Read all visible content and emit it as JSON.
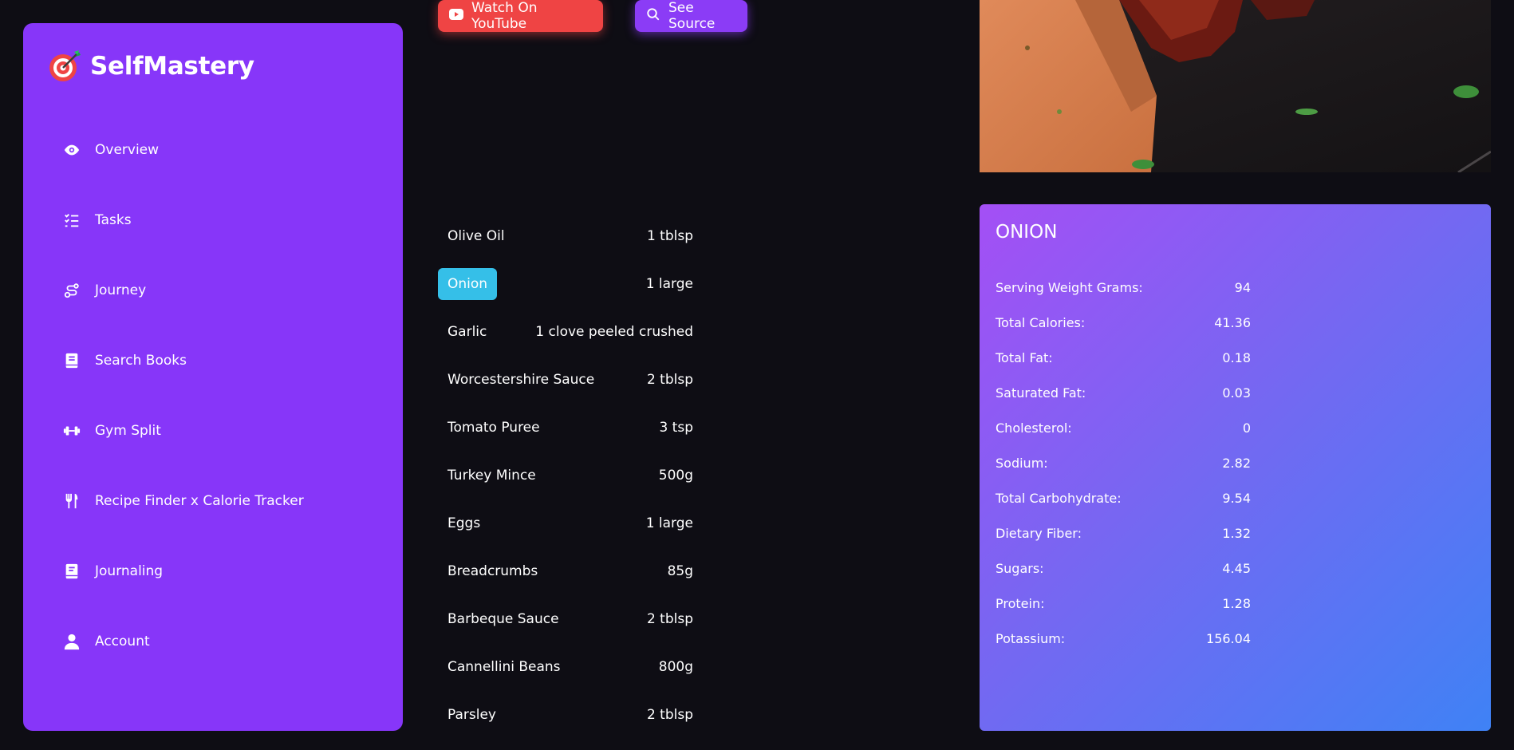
{
  "brand": {
    "name": "SelfMastery",
    "icon": "target-icon"
  },
  "nav": [
    {
      "label": "Overview",
      "icon": "eye-icon"
    },
    {
      "label": "Tasks",
      "icon": "tasks-list-icon"
    },
    {
      "label": "Journey",
      "icon": "route-icon"
    },
    {
      "label": "Search Books",
      "icon": "book-icon"
    },
    {
      "label": "Gym Split",
      "icon": "dumbbell-icon"
    },
    {
      "label": "Recipe Finder x Calorie Tracker",
      "icon": "utensils-icon"
    },
    {
      "label": "Journaling",
      "icon": "journal-icon"
    },
    {
      "label": "Account",
      "icon": "user-icon"
    }
  ],
  "buttons": {
    "youtube": "Watch On YouTube",
    "source": "See Source"
  },
  "ingredients": [
    {
      "name": "Olive Oil",
      "qty": "1 tblsp"
    },
    {
      "name": "Onion",
      "qty": "1 large",
      "selected": true
    },
    {
      "name": "Garlic",
      "qty": "1 clove peeled crushed"
    },
    {
      "name": "Worcestershire Sauce",
      "qty": "2 tblsp"
    },
    {
      "name": "Tomato Puree",
      "qty": "3 tsp"
    },
    {
      "name": "Turkey Mince",
      "qty": "500g"
    },
    {
      "name": "Eggs",
      "qty": "1 large"
    },
    {
      "name": "Breadcrumbs",
      "qty": "85g"
    },
    {
      "name": "Barbeque Sauce",
      "qty": "2 tblsp"
    },
    {
      "name": "Cannellini Beans",
      "qty": "800g"
    },
    {
      "name": "Parsley",
      "qty": "2 tblsp"
    }
  ],
  "nutrition": {
    "title": "ONION",
    "rows": [
      {
        "label": "Serving Weight Grams:",
        "value": "94"
      },
      {
        "label": "Total Calories:",
        "value": "41.36"
      },
      {
        "label": "Total Fat:",
        "value": "0.18"
      },
      {
        "label": "Saturated Fat:",
        "value": "0.03"
      },
      {
        "label": "Cholesterol:",
        "value": "0"
      },
      {
        "label": "Sodium:",
        "value": "2.82"
      },
      {
        "label": "Total Carbohydrate:",
        "value": "9.54"
      },
      {
        "label": "Dietary Fiber:",
        "value": "1.32"
      },
      {
        "label": "Sugars:",
        "value": "4.45"
      },
      {
        "label": "Protein:",
        "value": "1.28"
      },
      {
        "label": "Potassium:",
        "value": "156.04"
      }
    ]
  },
  "colors": {
    "background": "#0e0d14",
    "sidebar": "#8736f9",
    "youtube_button": "#ef4444",
    "source_button": "#8b3cf6",
    "selected_ingredient": "#35bfe8"
  }
}
